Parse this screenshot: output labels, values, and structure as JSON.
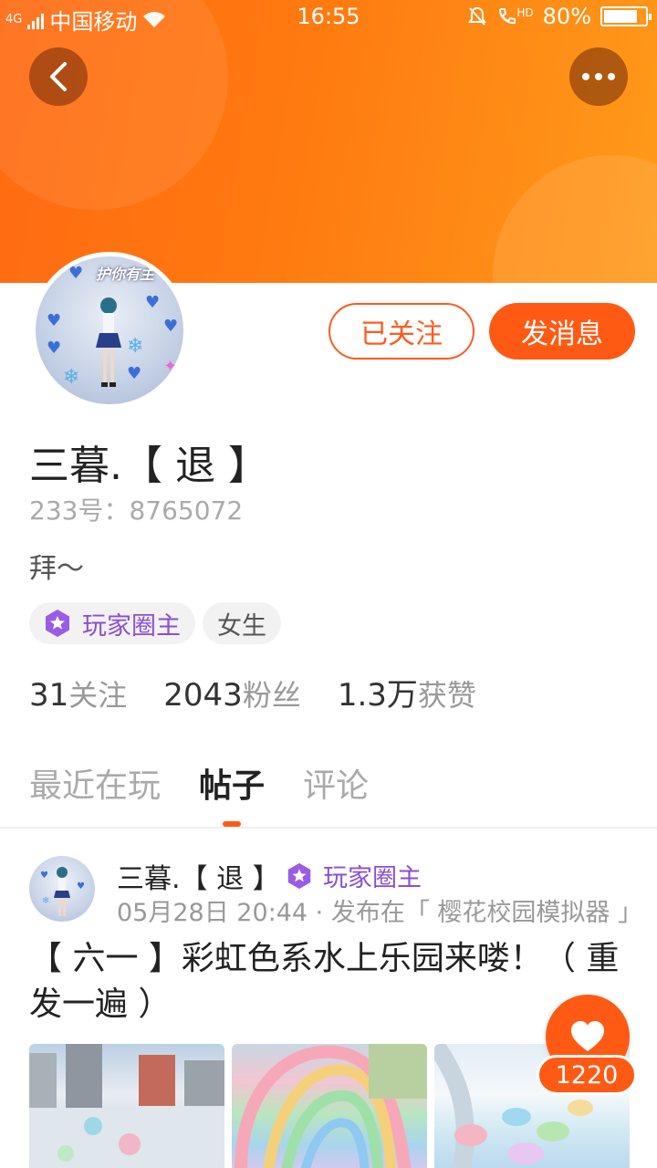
{
  "status_bar": {
    "network": "4G",
    "carrier": "中国移动",
    "time": "16:55",
    "volte": "HD",
    "battery": "80%"
  },
  "profile": {
    "name": "三暮.【 退 】",
    "uid_label": "233号：",
    "uid": "8765072",
    "bio": "拜～",
    "follow_button": "已关注",
    "message_button": "发消息",
    "tags": [
      "玩家圈主",
      "女生"
    ],
    "avatar_text": "护你有主",
    "stats": [
      {
        "num": "31",
        "label": "关注"
      },
      {
        "num": "2043",
        "label": "粉丝"
      },
      {
        "num": "1.3万",
        "label": "获赞"
      }
    ]
  },
  "tabs": [
    {
      "label": "最近在玩",
      "active": false
    },
    {
      "label": "帖子",
      "active": true
    },
    {
      "label": "评论",
      "active": false
    }
  ],
  "post": {
    "author": "三暮.【 退 】",
    "author_badge": "玩家圈主",
    "meta": "05月28日 20:44 · 发布在「 樱花校园模拟器 」",
    "title": "【 六一 】彩虹色系水上乐园来喽！（ 重发一遍 ）",
    "likes": "1220"
  },
  "colors": {
    "accent": "#ff5a14",
    "header_start": "#ff6a12",
    "header_end": "#ff9a1a",
    "badge_purple": "#8a4fd6"
  },
  "icons": {
    "back": "chevron-left-icon",
    "more": "more-dots-icon",
    "like": "heart-icon",
    "owner_badge": "star-badge-icon"
  }
}
